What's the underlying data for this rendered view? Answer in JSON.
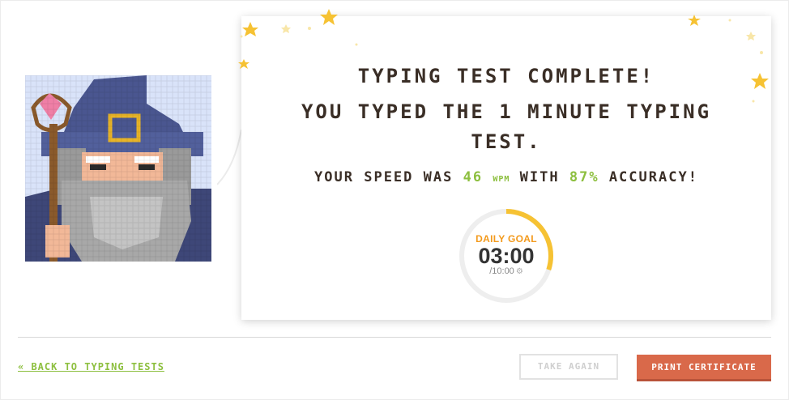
{
  "result": {
    "title": "TYPING TEST COMPLETE!",
    "subtitle": "YOU TYPED THE 1 MINUTE TYPING TEST.",
    "speed_prefix": "YOUR SPEED WAS",
    "wpm": "46",
    "wpm_unit": "WPM",
    "speed_middle": "WITH",
    "accuracy": "87%",
    "speed_suffix": "ACCURACY!"
  },
  "daily_goal": {
    "label": "DAILY GOAL",
    "time": "03:00",
    "total": "/10:00",
    "progress_fraction": 0.3,
    "progress_color": "#f6c233",
    "track_color": "#eeeeee"
  },
  "footer": {
    "back_link": "« BACK TO TYPING TESTS",
    "take_again": "TAKE AGAIN",
    "print_certificate": "PRINT CERTIFICATE"
  },
  "colors": {
    "accent_green": "#8dbf3f",
    "primary_button": "#d9694a",
    "text_dark": "#3a2e26",
    "goal_orange": "#f39a1c"
  },
  "icons": {
    "avatar": "wizard-avatar",
    "goal_settings": "gear-icon",
    "decoration": "star-icon"
  }
}
